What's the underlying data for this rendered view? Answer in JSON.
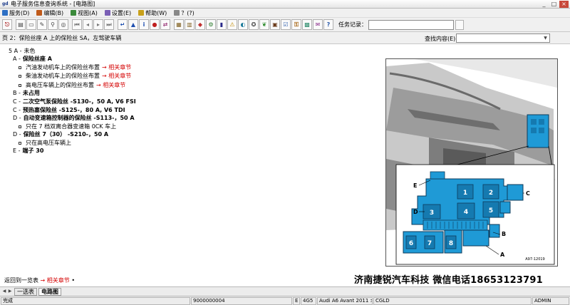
{
  "window": {
    "app_title": "电子服务信息查询系统 - [电路图]",
    "logo": "gd",
    "controls": [
      "_",
      "□",
      "×"
    ]
  },
  "menu": [
    {
      "label": "服务(D)",
      "icon_color": "#2d6fc4"
    },
    {
      "label": "编辑(B)",
      "icon_color": "#c05a1a"
    },
    {
      "label": "视图(A)",
      "icon_color": "#3b8a3b"
    },
    {
      "label": "设置(E)",
      "icon_color": "#7a5fb5"
    },
    {
      "label": "帮助(W)",
      "icon_color": "#c8a01a"
    },
    {
      "label": "？(?)",
      "icon_color": "#888888"
    }
  ],
  "toolbar": {
    "buttons": [
      {
        "icon": "exit-icon",
        "glyph": "⎋",
        "color": "#b03030"
      },
      {
        "sep": true
      },
      {
        "icon": "print-icon",
        "glyph": "▤",
        "color": "#444444"
      },
      {
        "icon": "open-icon",
        "glyph": "▭",
        "color": "#444444"
      },
      {
        "icon": "edit-icon",
        "glyph": "✎",
        "color": "#444444"
      },
      {
        "icon": "zoom-icon",
        "glyph": "⚲",
        "color": "#444444"
      },
      {
        "icon": "search-icon",
        "glyph": "◎",
        "color": "#444444"
      },
      {
        "sep": true
      },
      {
        "icon": "first-icon",
        "glyph": "⏮",
        "color": "#777777"
      },
      {
        "icon": "prev-icon",
        "glyph": "◂",
        "color": "#777777"
      },
      {
        "icon": "next-icon",
        "glyph": "▸",
        "color": "#777777"
      },
      {
        "icon": "last-icon",
        "glyph": "⏭",
        "color": "#777777"
      },
      {
        "sep": true
      },
      {
        "icon": "return-icon",
        "glyph": "↵",
        "color": "#2050b0"
      },
      {
        "icon": "up-icon",
        "glyph": "▲",
        "color": "#2050b0"
      },
      {
        "icon": "info-icon",
        "glyph": "i",
        "color": "#2050b0"
      },
      {
        "icon": "stop-icon",
        "glyph": "●",
        "color": "#c02020"
      },
      {
        "icon": "swap-icon",
        "glyph": "⇄",
        "color": "#a04080"
      },
      {
        "sep": true
      },
      {
        "icon": "schema-icon",
        "glyph": "▦",
        "color": "#806020"
      },
      {
        "icon": "document-icon",
        "glyph": "▥",
        "color": "#806020"
      },
      {
        "icon": "car-icon",
        "glyph": "◆",
        "color": "#c03030"
      },
      {
        "icon": "tool-icon",
        "glyph": "⚙",
        "color": "#2a7a2a"
      },
      {
        "icon": "book-icon",
        "glyph": "▮",
        "color": "#2a2a8a"
      },
      {
        "icon": "warning-icon",
        "glyph": "⚠",
        "color": "#c08a00"
      },
      {
        "icon": "globe-icon",
        "glyph": "◐",
        "color": "#1a7a9a"
      },
      {
        "icon": "wheel-icon",
        "glyph": "✪",
        "color": "#3a3a3a"
      },
      {
        "icon": "leaf-icon",
        "glyph": "❦",
        "color": "#2a8a2a"
      },
      {
        "icon": "engine-icon",
        "glyph": "▣",
        "color": "#6a3a1a"
      },
      {
        "icon": "checklist-icon",
        "glyph": "☑",
        "color": "#2a5aaa"
      },
      {
        "icon": "key-icon",
        "glyph": "⚿",
        "color": "#aa6a1a"
      },
      {
        "icon": "map-icon",
        "glyph": "▩",
        "color": "#2a8a6a"
      },
      {
        "icon": "note-icon",
        "glyph": "✉",
        "color": "#8a2a8a"
      },
      {
        "icon": "help-icon",
        "glyph": "?",
        "color": "#2a5aaa"
      }
    ],
    "task_label": "任务记录："
  },
  "pagebar": {
    "title": "页 2：保险丝座 A 上的保险丝 SA，左驾驶车辆",
    "find_label": "查找内容(E)："
  },
  "content": {
    "lines": [
      {
        "indent": 12,
        "prefix": "5 A -",
        "text": "未色",
        "bold": false
      },
      {
        "indent": 18,
        "prefix": "A -",
        "text": "保险丝座 A",
        "bold": true
      },
      {
        "indent": 26,
        "bullet": true,
        "text": "汽油发动机车上的保险丝布置",
        "link": "→ 相关章节"
      },
      {
        "indent": 26,
        "bullet": true,
        "text": "柴油发动机车上的保险丝布置",
        "link": "→ 相关章节"
      },
      {
        "indent": 26,
        "bullet": true,
        "text": "高电压车辆上的保险丝布置",
        "link": "→ 相关章节"
      },
      {
        "indent": 18,
        "prefix": "B -",
        "text": "未占用",
        "bold": true
      },
      {
        "indent": 18,
        "prefix": "C -",
        "text": "二次空气泵保险丝 -S130-，50 A, V6 FSI",
        "bold": true
      },
      {
        "indent": 18,
        "prefix": "C -",
        "text": "预热塞保险丝 -S125-，80 A, V6 TDI",
        "bold": true
      },
      {
        "indent": 18,
        "prefix": "D -",
        "text": "自动变速箱控制器的保险丝 -S113-，50 A",
        "bold": true
      },
      {
        "indent": 26,
        "bullet": true,
        "text": "只在 7 档双离合器变速箱 0CK 车上"
      },
      {
        "indent": 18,
        "prefix": "D -",
        "text": "保险丝 7（30） -S210-，50 A",
        "bold": true
      },
      {
        "indent": 26,
        "bullet": true,
        "text": "只在高电压车辆上"
      },
      {
        "indent": 18,
        "prefix": "E -",
        "text": "端子 30",
        "bold": true
      }
    ],
    "return_text": "返回到一览表",
    "return_link": "→ 相关章节",
    "return_suffix": "•"
  },
  "diagram": {
    "labels": {
      "A": "A",
      "B": "B",
      "C": "C",
      "D": "D",
      "E": "E"
    },
    "fuse_numbers": [
      "1",
      "2",
      "3",
      "4",
      "5",
      "6",
      "7",
      "8"
    ],
    "figure_id": "A97-12019",
    "colors": {
      "fuse_blue": "#1f9ad6",
      "outline": "#0d3a5a",
      "photo_gray": "#8e8e8e"
    }
  },
  "watermark": "济南捷锐汽车科技 微信电话18653123791",
  "tabs": [
    {
      "label": "一选表",
      "active": false
    },
    {
      "label": "电路图",
      "active": true
    }
  ],
  "status": {
    "state": "完成",
    "code": "9000000004",
    "e_flag": "E",
    "model_code": "4G5",
    "vehicle": "Audi A6 Avant 2011 >",
    "engine": "CGLD",
    "user": "ADMIN"
  }
}
